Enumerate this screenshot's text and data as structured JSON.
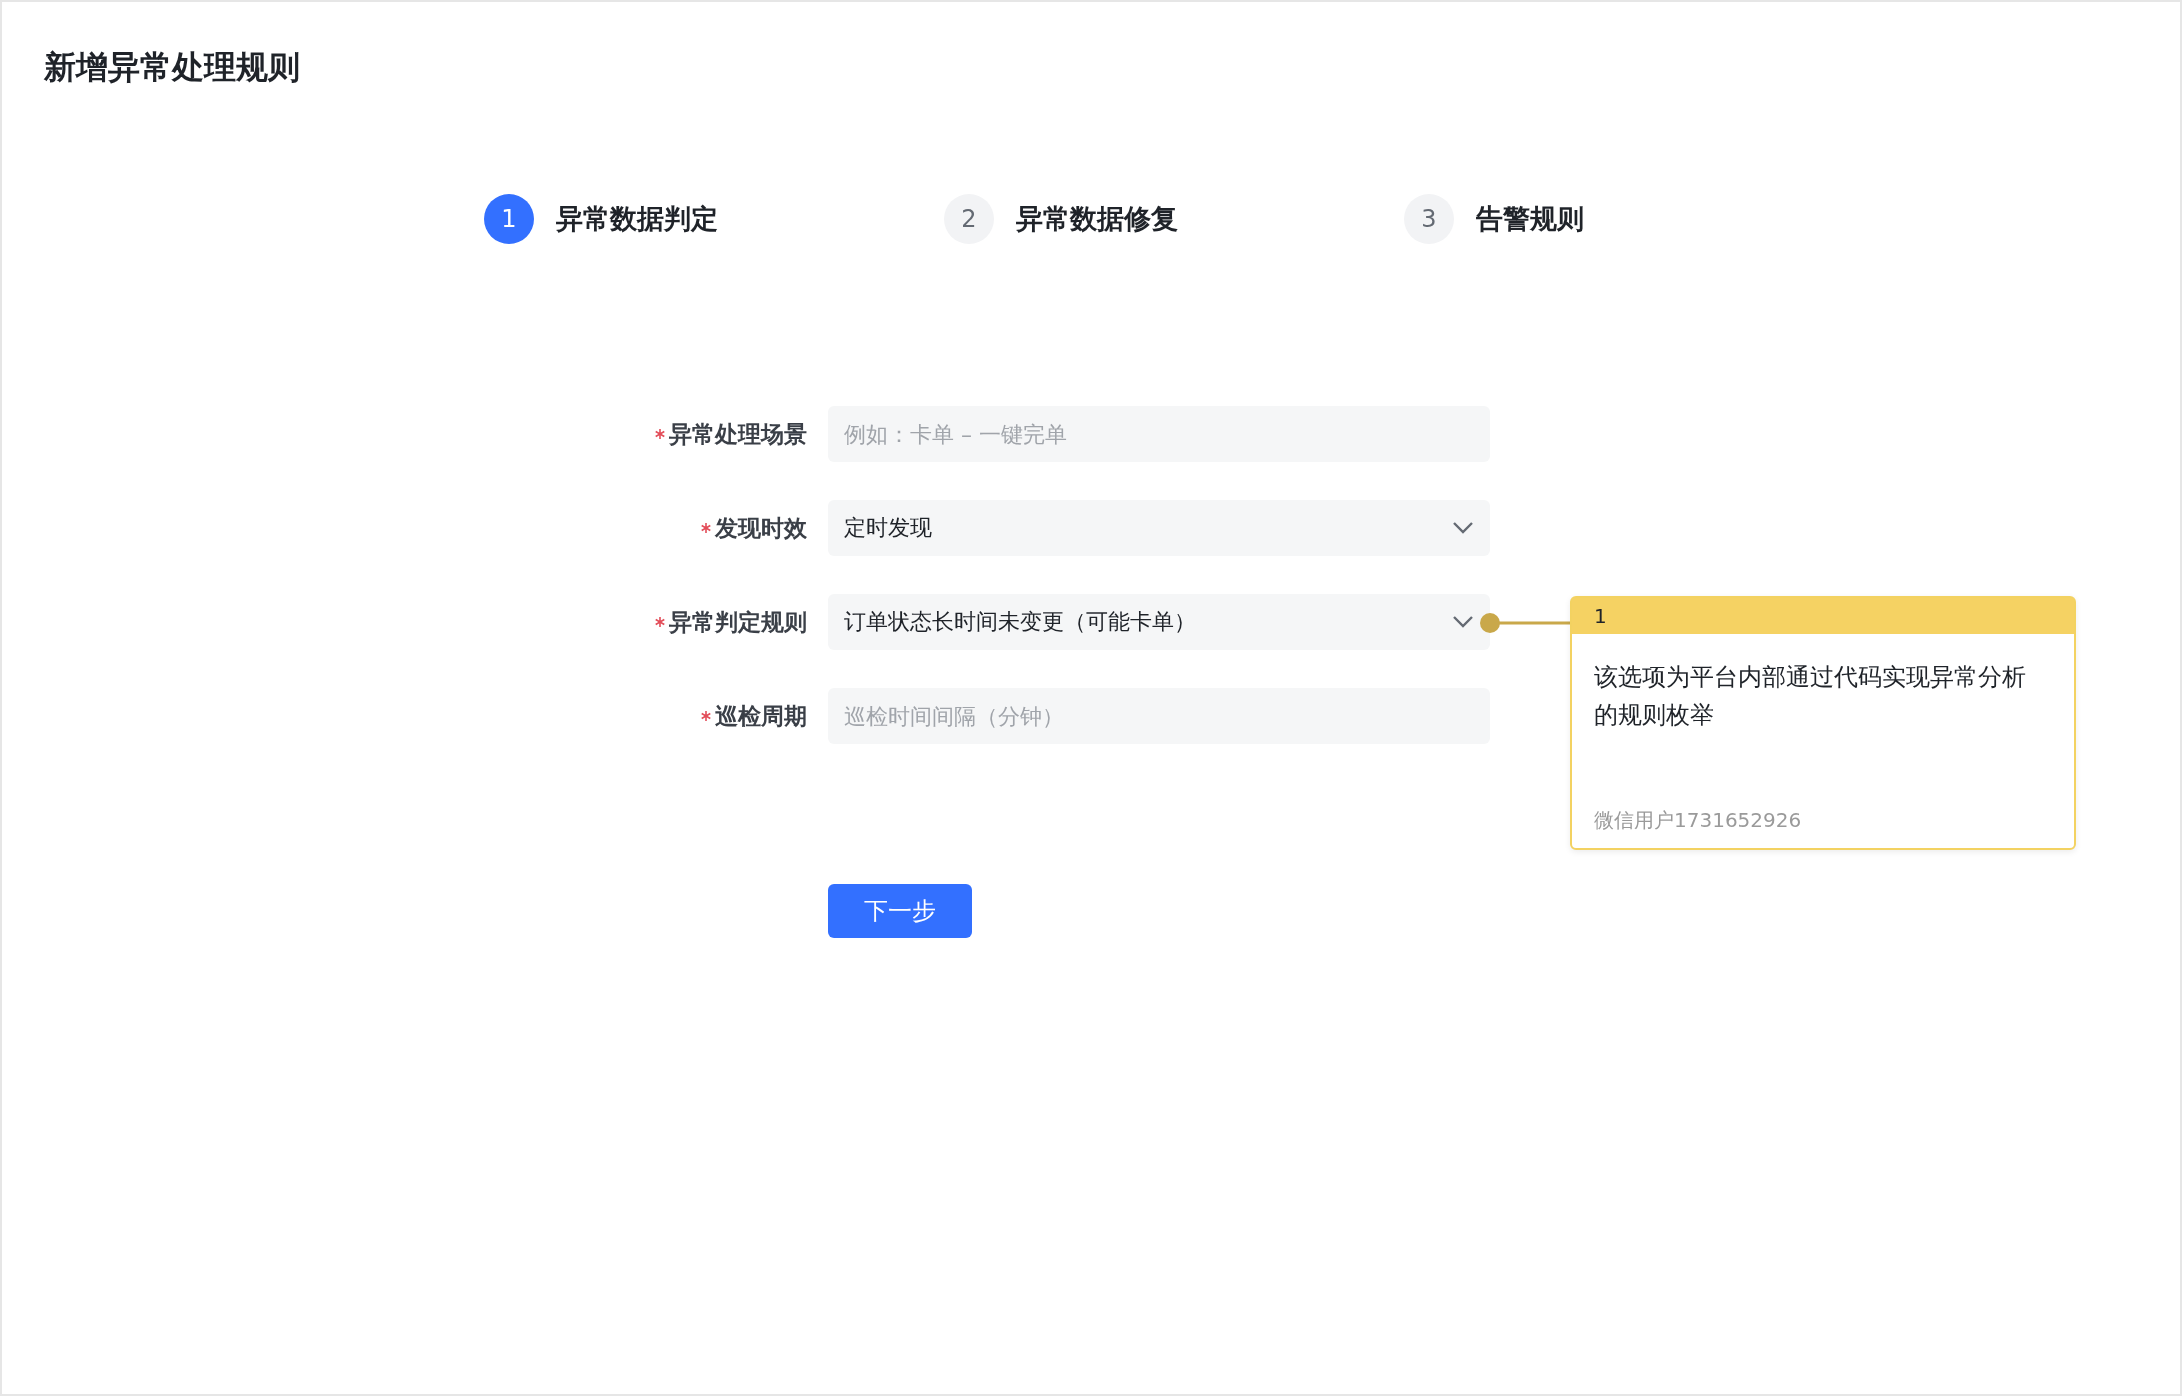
{
  "page": {
    "title": "新增异常处理规则"
  },
  "steps": [
    {
      "number": "1",
      "label": "异常数据判定",
      "selected": true
    },
    {
      "number": "2",
      "label": "异常数据修复",
      "selected": false
    },
    {
      "number": "3",
      "label": "告警规则",
      "selected": false
    }
  ],
  "form": {
    "fields": [
      {
        "kind": "input",
        "label": "异常处理场景",
        "required": true,
        "placeholder": "例如：卡单 – 一键完单"
      },
      {
        "kind": "select",
        "label": "发现时效",
        "required": true,
        "value": "定时发现"
      },
      {
        "kind": "select",
        "label": "异常判定规则",
        "required": true,
        "value": "订单状态长时间未变更（可能卡单）",
        "note": {
          "number": "1",
          "text": "该选项为平台内部通过代码实现异常分析的规则枚举",
          "author": "微信用户1731652926"
        }
      },
      {
        "kind": "input",
        "label": "巡检周期",
        "required": true,
        "placeholder": "巡检时间间隔（分钟）"
      }
    ],
    "submit": "下一步"
  }
}
